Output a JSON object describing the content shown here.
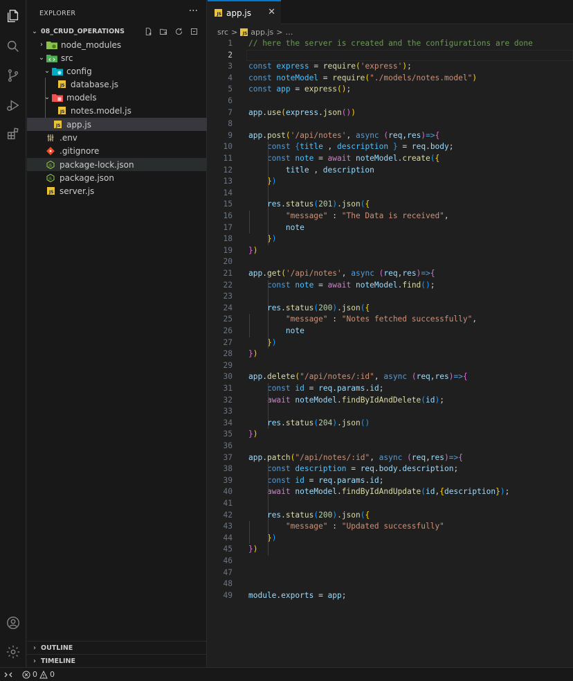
{
  "colors": {
    "accent": "#0078d4",
    "js_badge": "#e8c33b",
    "node_green": "#8bc34a",
    "git_red": "#f14c28"
  },
  "activity_bar": {
    "items": [
      {
        "name": "explorer-icon"
      },
      {
        "name": "search-icon"
      },
      {
        "name": "source-control-icon"
      },
      {
        "name": "run-debug-icon"
      },
      {
        "name": "extensions-icon"
      }
    ],
    "bottom": [
      {
        "name": "account-icon"
      },
      {
        "name": "settings-gear-icon"
      }
    ]
  },
  "sidebar": {
    "title": "EXPLORER",
    "more": "···",
    "project": "08_CRUD_OPERATIONS",
    "tree": [
      {
        "label": "node_modules",
        "icon": "folder-node-icon",
        "chevron": "›"
      },
      {
        "label": "src",
        "icon": "folder-src-icon",
        "chevron": "⌄"
      },
      {
        "label": "config",
        "icon": "folder-config-icon",
        "chevron": "⌄"
      },
      {
        "label": "database.js",
        "icon": "js-file-icon"
      },
      {
        "label": "models",
        "icon": "folder-models-icon",
        "chevron": "⌄"
      },
      {
        "label": "notes.model.js",
        "icon": "js-file-icon"
      },
      {
        "label": "app.js",
        "icon": "js-file-icon"
      },
      {
        "label": ".env",
        "icon": "env-file-icon"
      },
      {
        "label": ".gitignore",
        "icon": "git-file-icon"
      },
      {
        "label": "package-lock.json",
        "icon": "node-json-icon"
      },
      {
        "label": "package.json",
        "icon": "node-json-icon"
      },
      {
        "label": "server.js",
        "icon": "js-file-icon"
      }
    ],
    "outline": "OUTLINE",
    "timeline": "TIMELINE"
  },
  "editor": {
    "tab": {
      "label": "app.js",
      "close": "✕"
    },
    "breadcrumb": {
      "segment1": "src",
      "sep": ">",
      "segment2": "app.js",
      "sep2": ">",
      "more": "…"
    },
    "current_line": 2,
    "lines": [
      [
        [
          "c",
          "// here the server is created and the configurations are done"
        ]
      ],
      [],
      [
        [
          "k",
          "const "
        ],
        [
          "cn",
          "express"
        ],
        [
          "p",
          " = "
        ],
        [
          "f",
          "require"
        ],
        [
          "b1",
          "("
        ],
        [
          "s",
          "'express'"
        ],
        [
          "b1",
          ")"
        ],
        [
          "p",
          ";"
        ]
      ],
      [
        [
          "k",
          "const "
        ],
        [
          "cn",
          "noteModel"
        ],
        [
          "p",
          " = "
        ],
        [
          "f",
          "require"
        ],
        [
          "b1",
          "("
        ],
        [
          "s",
          "\"./models/notes.model\""
        ],
        [
          "b1",
          ")"
        ]
      ],
      [
        [
          "k",
          "const "
        ],
        [
          "cn",
          "app"
        ],
        [
          "p",
          " = "
        ],
        [
          "f",
          "express"
        ],
        [
          "b1",
          "()"
        ],
        [
          "p",
          ";"
        ]
      ],
      [],
      [
        [
          "v",
          "app"
        ],
        [
          "p",
          "."
        ],
        [
          "f",
          "use"
        ],
        [
          "b1",
          "("
        ],
        [
          "v",
          "express"
        ],
        [
          "p",
          "."
        ],
        [
          "f",
          "json"
        ],
        [
          "b2",
          "()"
        ],
        [
          "b1",
          ")"
        ]
      ],
      [],
      [
        [
          "v",
          "app"
        ],
        [
          "p",
          "."
        ],
        [
          "f",
          "post"
        ],
        [
          "b1",
          "("
        ],
        [
          "s",
          "'/api/notes'"
        ],
        [
          "p",
          ", "
        ],
        [
          "k",
          "async "
        ],
        [
          "b2",
          "("
        ],
        [
          "v",
          "req"
        ],
        [
          "p",
          ","
        ],
        [
          "v",
          "res"
        ],
        [
          "b2",
          ")"
        ],
        [
          "k",
          "=>"
        ],
        [
          "b2",
          "{"
        ]
      ],
      [
        [
          "p",
          "    "
        ],
        [
          "k",
          "const "
        ],
        [
          "b3",
          "{"
        ],
        [
          "cn",
          "title"
        ],
        [
          "p",
          " , "
        ],
        [
          "cn",
          "description"
        ],
        [
          "p",
          " "
        ],
        [
          "b3",
          "}"
        ],
        [
          "p",
          " = "
        ],
        [
          "v",
          "req"
        ],
        [
          "p",
          "."
        ],
        [
          "v",
          "body"
        ],
        [
          "p",
          ";"
        ]
      ],
      [
        [
          "p",
          "    "
        ],
        [
          "k",
          "const "
        ],
        [
          "cn",
          "note"
        ],
        [
          "p",
          " = "
        ],
        [
          "kc",
          "await "
        ],
        [
          "v",
          "noteModel"
        ],
        [
          "p",
          "."
        ],
        [
          "f",
          "create"
        ],
        [
          "b3",
          "("
        ],
        [
          "b1",
          "{"
        ]
      ],
      [
        [
          "p",
          "        "
        ],
        [
          "v",
          "title"
        ],
        [
          "p",
          " , "
        ],
        [
          "v",
          "description"
        ]
      ],
      [
        [
          "p",
          "    "
        ],
        [
          "b1",
          "}"
        ],
        [
          "b3",
          ")"
        ]
      ],
      [],
      [
        [
          "p",
          "    "
        ],
        [
          "v",
          "res"
        ],
        [
          "p",
          "."
        ],
        [
          "f",
          "status"
        ],
        [
          "b3",
          "("
        ],
        [
          "n",
          "201"
        ],
        [
          "b3",
          ")"
        ],
        [
          "p",
          "."
        ],
        [
          "f",
          "json"
        ],
        [
          "b3",
          "("
        ],
        [
          "b1",
          "{"
        ]
      ],
      [
        [
          "p",
          "        "
        ],
        [
          "s",
          "\"message\""
        ],
        [
          "p",
          " : "
        ],
        [
          "s",
          "\"The Data is received\""
        ],
        [
          "p",
          ","
        ]
      ],
      [
        [
          "p",
          "        "
        ],
        [
          "v",
          "note"
        ]
      ],
      [
        [
          "p",
          "    "
        ],
        [
          "b1",
          "}"
        ],
        [
          "b3",
          ")"
        ]
      ],
      [
        [
          "b2",
          "}"
        ],
        [
          "b1",
          ")"
        ]
      ],
      [],
      [
        [
          "v",
          "app"
        ],
        [
          "p",
          "."
        ],
        [
          "f",
          "get"
        ],
        [
          "b1",
          "("
        ],
        [
          "s",
          "'/api/notes'"
        ],
        [
          "p",
          ", "
        ],
        [
          "k",
          "async "
        ],
        [
          "b2",
          "("
        ],
        [
          "v",
          "req"
        ],
        [
          "p",
          ","
        ],
        [
          "v",
          "res"
        ],
        [
          "b2",
          ")"
        ],
        [
          "k",
          "=>"
        ],
        [
          "b2",
          "{"
        ]
      ],
      [
        [
          "p",
          "    "
        ],
        [
          "k",
          "const "
        ],
        [
          "cn",
          "note"
        ],
        [
          "p",
          " = "
        ],
        [
          "kc",
          "await "
        ],
        [
          "v",
          "noteModel"
        ],
        [
          "p",
          "."
        ],
        [
          "f",
          "find"
        ],
        [
          "b3",
          "()"
        ],
        [
          "p",
          ";"
        ]
      ],
      [],
      [
        [
          "p",
          "    "
        ],
        [
          "v",
          "res"
        ],
        [
          "p",
          "."
        ],
        [
          "f",
          "status"
        ],
        [
          "b3",
          "("
        ],
        [
          "n",
          "200"
        ],
        [
          "b3",
          ")"
        ],
        [
          "p",
          "."
        ],
        [
          "f",
          "json"
        ],
        [
          "b3",
          "("
        ],
        [
          "b1",
          "{"
        ]
      ],
      [
        [
          "p",
          "        "
        ],
        [
          "s",
          "\"message\""
        ],
        [
          "p",
          " : "
        ],
        [
          "s",
          "\"Notes fetched successfully\""
        ],
        [
          "p",
          ","
        ]
      ],
      [
        [
          "p",
          "        "
        ],
        [
          "v",
          "note"
        ]
      ],
      [
        [
          "p",
          "    "
        ],
        [
          "b1",
          "}"
        ],
        [
          "b3",
          ")"
        ]
      ],
      [
        [
          "b2",
          "}"
        ],
        [
          "b1",
          ")"
        ]
      ],
      [],
      [
        [
          "v",
          "app"
        ],
        [
          "p",
          "."
        ],
        [
          "f",
          "delete"
        ],
        [
          "b1",
          "("
        ],
        [
          "s",
          "\"/api/notes/:id\""
        ],
        [
          "p",
          ", "
        ],
        [
          "k",
          "async "
        ],
        [
          "b2",
          "("
        ],
        [
          "v",
          "req"
        ],
        [
          "p",
          ","
        ],
        [
          "v",
          "res"
        ],
        [
          "b2",
          ")"
        ],
        [
          "k",
          "=>"
        ],
        [
          "b2",
          "{"
        ]
      ],
      [
        [
          "p",
          "    "
        ],
        [
          "k",
          "const "
        ],
        [
          "cn",
          "id"
        ],
        [
          "p",
          " = "
        ],
        [
          "v",
          "req"
        ],
        [
          "p",
          "."
        ],
        [
          "v",
          "params"
        ],
        [
          "p",
          "."
        ],
        [
          "v",
          "id"
        ],
        [
          "p",
          ";"
        ]
      ],
      [
        [
          "p",
          "    "
        ],
        [
          "kc",
          "await "
        ],
        [
          "v",
          "noteModel"
        ],
        [
          "p",
          "."
        ],
        [
          "f",
          "findByIdAndDelete"
        ],
        [
          "b3",
          "("
        ],
        [
          "v",
          "id"
        ],
        [
          "b3",
          ")"
        ],
        [
          "p",
          ";"
        ]
      ],
      [],
      [
        [
          "p",
          "    "
        ],
        [
          "v",
          "res"
        ],
        [
          "p",
          "."
        ],
        [
          "f",
          "status"
        ],
        [
          "b3",
          "("
        ],
        [
          "n",
          "204"
        ],
        [
          "b3",
          ")"
        ],
        [
          "p",
          "."
        ],
        [
          "f",
          "json"
        ],
        [
          "b3",
          "()"
        ]
      ],
      [
        [
          "b2",
          "}"
        ],
        [
          "b1",
          ")"
        ]
      ],
      [],
      [
        [
          "v",
          "app"
        ],
        [
          "p",
          "."
        ],
        [
          "f",
          "patch"
        ],
        [
          "b1",
          "("
        ],
        [
          "s",
          "\"/api/notes/:id\""
        ],
        [
          "p",
          ", "
        ],
        [
          "k",
          "async "
        ],
        [
          "b2",
          "("
        ],
        [
          "v",
          "req"
        ],
        [
          "p",
          ","
        ],
        [
          "v",
          "res"
        ],
        [
          "b2",
          ")"
        ],
        [
          "k",
          "=>"
        ],
        [
          "b2",
          "{"
        ]
      ],
      [
        [
          "p",
          "    "
        ],
        [
          "k",
          "const "
        ],
        [
          "cn",
          "description"
        ],
        [
          "p",
          " = "
        ],
        [
          "v",
          "req"
        ],
        [
          "p",
          "."
        ],
        [
          "v",
          "body"
        ],
        [
          "p",
          "."
        ],
        [
          "v",
          "description"
        ],
        [
          "p",
          ";"
        ]
      ],
      [
        [
          "p",
          "    "
        ],
        [
          "k",
          "const "
        ],
        [
          "cn",
          "id"
        ],
        [
          "p",
          " = "
        ],
        [
          "v",
          "req"
        ],
        [
          "p",
          "."
        ],
        [
          "v",
          "params"
        ],
        [
          "p",
          "."
        ],
        [
          "v",
          "id"
        ],
        [
          "p",
          ";"
        ]
      ],
      [
        [
          "p",
          "    "
        ],
        [
          "kc",
          "await "
        ],
        [
          "v",
          "noteModel"
        ],
        [
          "p",
          "."
        ],
        [
          "f",
          "findByIdAndUpdate"
        ],
        [
          "b3",
          "("
        ],
        [
          "v",
          "id"
        ],
        [
          "p",
          ","
        ],
        [
          "b1",
          "{"
        ],
        [
          "v",
          "description"
        ],
        [
          "b1",
          "}"
        ],
        [
          "b3",
          ")"
        ],
        [
          "p",
          ";"
        ]
      ],
      [],
      [
        [
          "p",
          "    "
        ],
        [
          "v",
          "res"
        ],
        [
          "p",
          "."
        ],
        [
          "f",
          "status"
        ],
        [
          "b3",
          "("
        ],
        [
          "n",
          "200"
        ],
        [
          "b3",
          ")"
        ],
        [
          "p",
          "."
        ],
        [
          "f",
          "json"
        ],
        [
          "b3",
          "("
        ],
        [
          "b1",
          "{"
        ]
      ],
      [
        [
          "p",
          "        "
        ],
        [
          "s",
          "\"message\""
        ],
        [
          "p",
          " : "
        ],
        [
          "s",
          "\"Updated successfully\""
        ]
      ],
      [
        [
          "p",
          "    "
        ],
        [
          "b1",
          "}"
        ],
        [
          "b3",
          ")"
        ]
      ],
      [
        [
          "b2",
          "}"
        ],
        [
          "b1",
          ")"
        ]
      ],
      [],
      [],
      [],
      [
        [
          "v",
          "module"
        ],
        [
          "p",
          "."
        ],
        [
          "v",
          "exports"
        ],
        [
          "p",
          " = "
        ],
        [
          "v",
          "app"
        ],
        [
          "p",
          ";"
        ]
      ]
    ]
  },
  "statusbar": {
    "errors": "0",
    "warnings": "0"
  }
}
